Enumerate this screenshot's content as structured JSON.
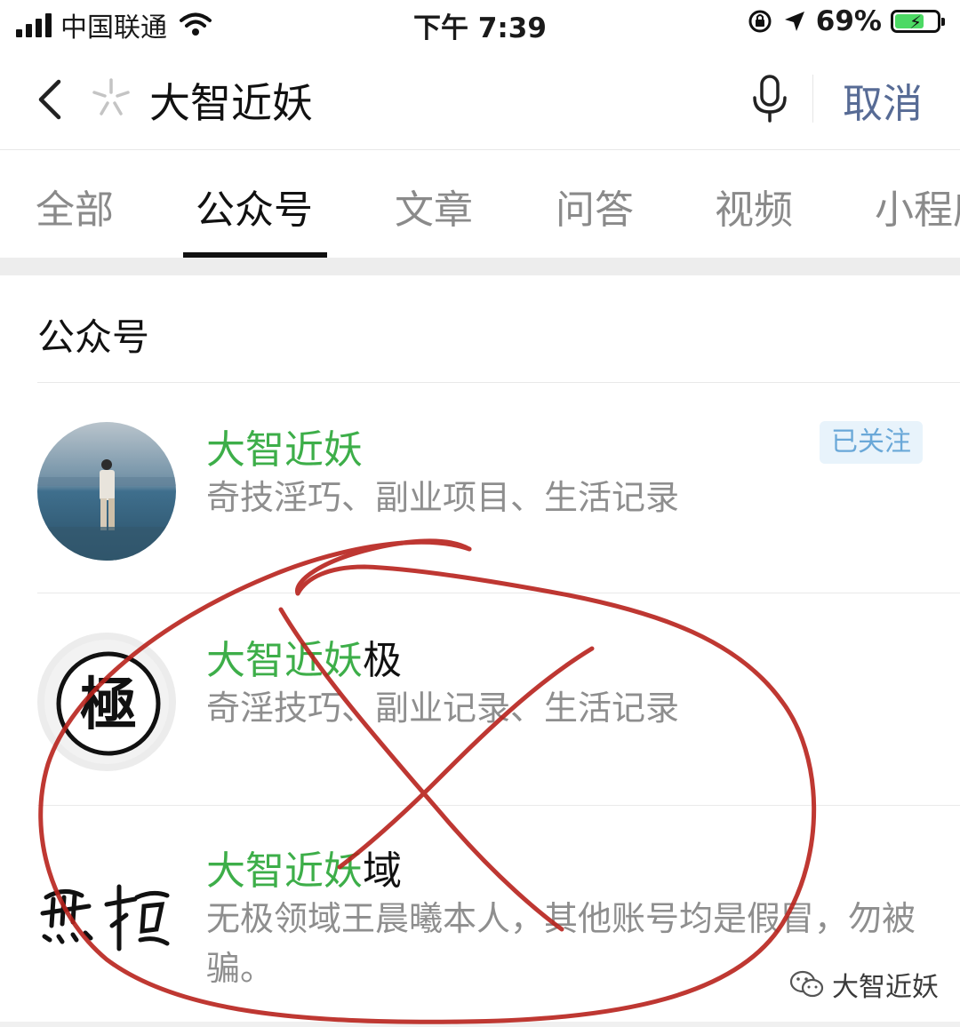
{
  "status_bar": {
    "carrier": "中国联通",
    "time": "下午 7:39",
    "battery": "69%",
    "battery_level": 0.69
  },
  "search": {
    "query": "大智近妖",
    "cancel_label": "取消"
  },
  "tabs": [
    {
      "label": "全部"
    },
    {
      "label": "公众号"
    },
    {
      "label": "文章"
    },
    {
      "label": "问答"
    },
    {
      "label": "视频"
    },
    {
      "label": "小程序"
    }
  ],
  "active_tab": "公众号",
  "section": {
    "title": "公众号"
  },
  "accounts": [
    {
      "name": "大智近妖",
      "name_suffix": "",
      "description": "奇技淫巧、副业项目、生活记录",
      "badge": "已关注",
      "avatar": "person-by-sea-avatar"
    },
    {
      "name": "大智近妖",
      "name_suffix": "极",
      "description": "奇淫技巧、副业记录、生活记录",
      "avatar": "ji-character-logo"
    },
    {
      "name": "大智近妖",
      "name_suffix": "域",
      "description": "无极领域王晨曦本人，其他账号均是假冒，勿被骗。",
      "avatar": "wuji-calligraphy-logo"
    }
  ],
  "watermark": {
    "text": "大智近妖",
    "icon": "wechat-icon"
  },
  "colors": {
    "name_green": "#3dae49",
    "cancel_blue": "#576b95",
    "badge_bg": "#e8f3fb",
    "badge_text": "#6aa8d8",
    "annotation_red": "#b8221c"
  }
}
